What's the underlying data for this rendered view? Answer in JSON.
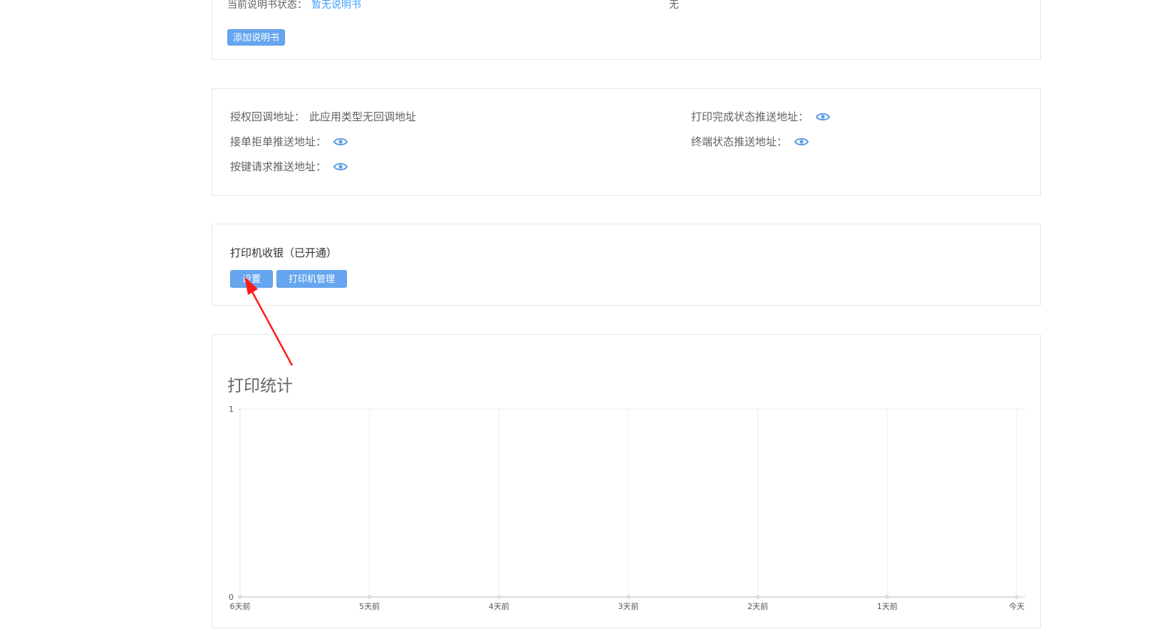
{
  "manual": {
    "status_label": "当前说明书状态：",
    "status_value": "暂无说明书",
    "right_value": "无",
    "add_button": "添加说明书"
  },
  "addresses": {
    "auth_callback_label": "授权回调地址：",
    "auth_callback_value": "此应用类型无回调地址",
    "accept_reject_label": "接单拒单推送地址：",
    "key_request_label": "按键请求推送地址：",
    "print_complete_label": "打印完成状态推送地址：",
    "terminal_status_label": "终端状态推送地址："
  },
  "printer": {
    "title": "打印机收银（已开通）",
    "settings_button": "设置",
    "manage_button": "打印机管理"
  },
  "stats": {
    "title": "打印统计"
  },
  "colors": {
    "accent": "#409eff",
    "button_bg": "#66a6ef",
    "annotation": "#ff1a1a"
  },
  "chart_data": {
    "type": "line",
    "categories": [
      "6天前",
      "5天前",
      "4天前",
      "3天前",
      "2天前",
      "1天前",
      "今天"
    ],
    "values": [
      0,
      0,
      0,
      0,
      0,
      0,
      0
    ],
    "title": "打印统计",
    "xlabel": "",
    "ylabel": "",
    "ylim": [
      0,
      1
    ],
    "yticks": [
      "0",
      "1"
    ],
    "grid": true
  }
}
